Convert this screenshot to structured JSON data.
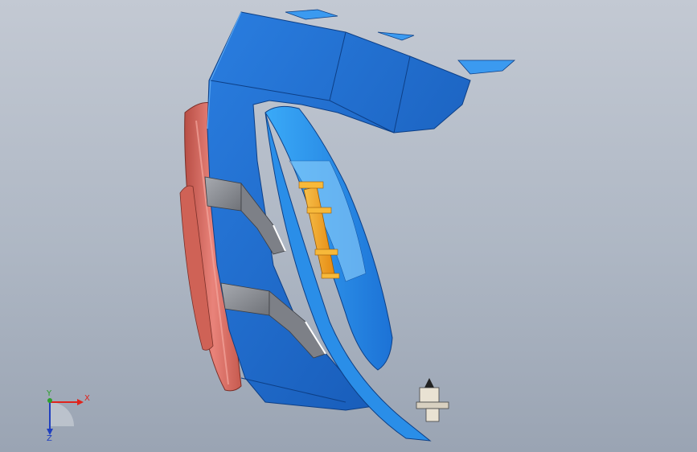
{
  "view": {
    "background_top": "#c3c9d3",
    "background_bottom": "#9aa4b3"
  },
  "model": {
    "parts": [
      {
        "name": "base-plate",
        "color": "#d66a5c"
      },
      {
        "name": "main-housing",
        "color": "#1f6fd1"
      },
      {
        "name": "inner-shell",
        "color": "#2f98f0"
      },
      {
        "name": "internal-rod",
        "color": "#f2a621"
      },
      {
        "name": "clamp-block",
        "color": "#8c8f95"
      },
      {
        "name": "fastener",
        "color": "#e9e2d3"
      }
    ]
  },
  "triad": {
    "x_label": "X",
    "y_label": "Y",
    "z_label": "Z",
    "x_color": "#e0231c",
    "y_color": "#2ca02c",
    "z_color": "#1f3fbf"
  }
}
